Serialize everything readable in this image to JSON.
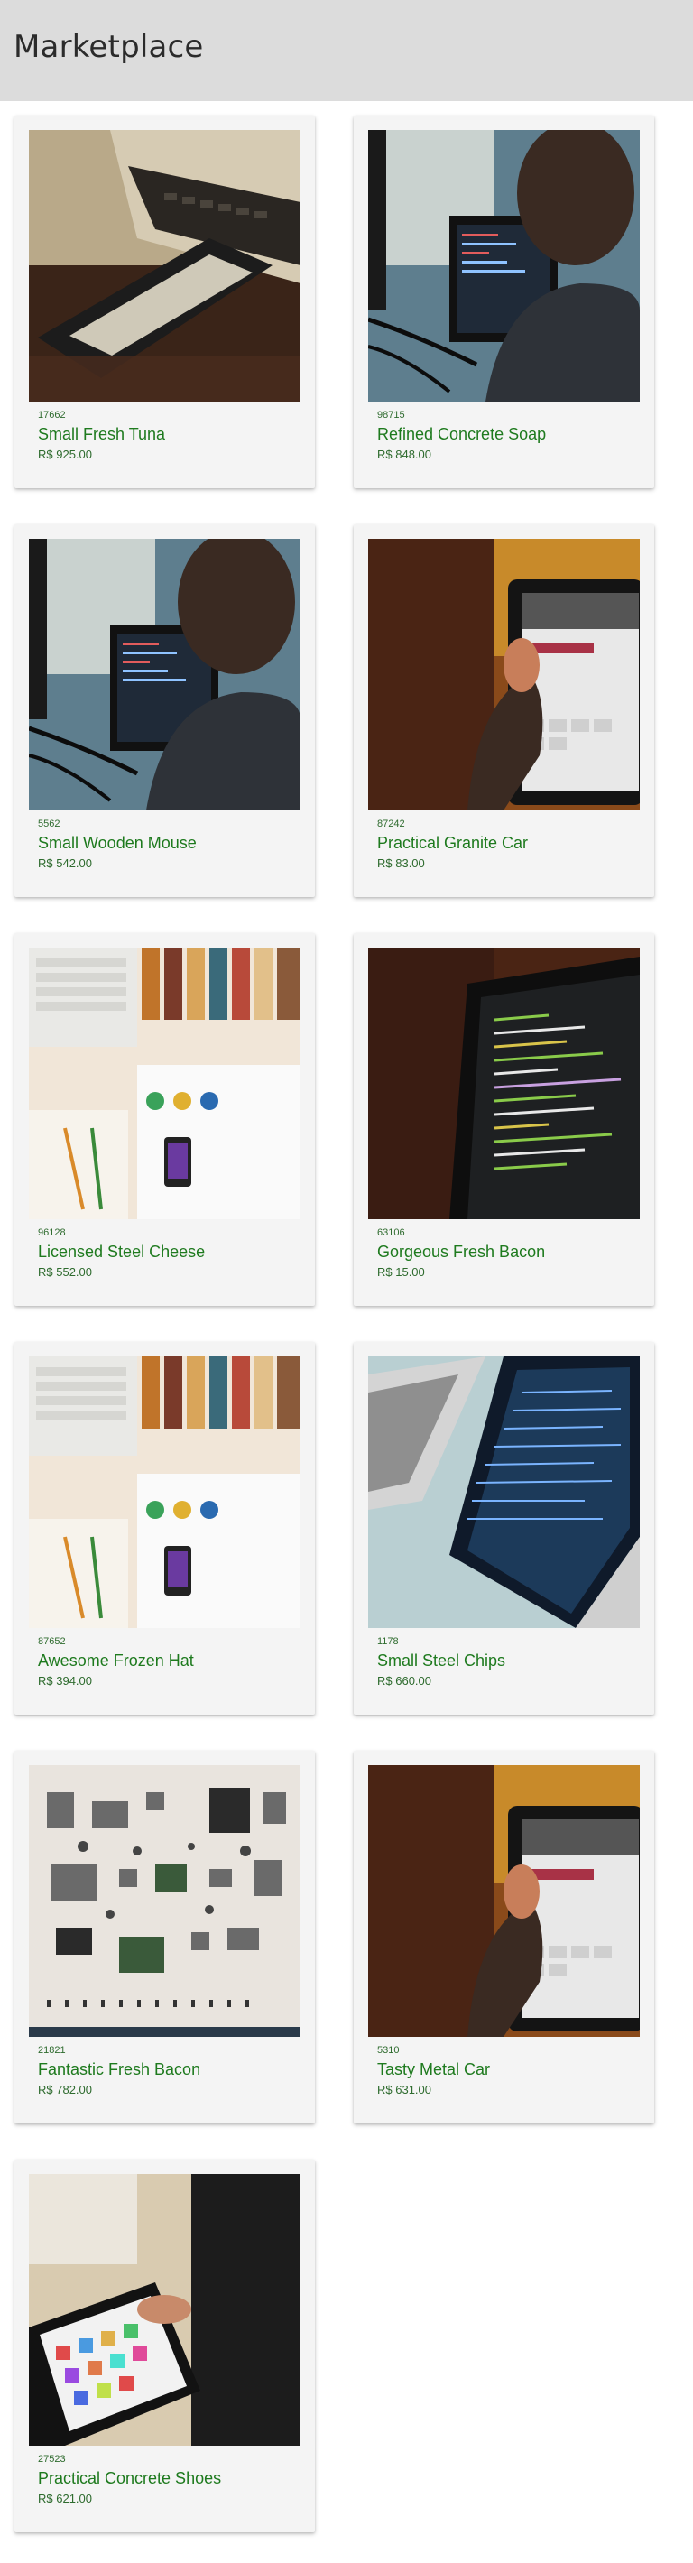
{
  "header": {
    "title": "Marketplace"
  },
  "products": [
    {
      "id": "17662",
      "name": "Small Fresh Tuna",
      "price": "R$ 925.00",
      "image": "phone-on-laptop"
    },
    {
      "id": "98715",
      "name": "Refined Concrete Soap",
      "price": "R$ 848.00",
      "image": "person-at-monitor"
    },
    {
      "id": "5562",
      "name": "Small Wooden Mouse",
      "price": "R$ 542.00",
      "image": "person-at-monitor"
    },
    {
      "id": "87242",
      "name": "Practical Granite Car",
      "price": "R$ 83.00",
      "image": "hand-holding-tablet"
    },
    {
      "id": "96128",
      "name": "Licensed Steel Cheese",
      "price": "R$ 552.00",
      "image": "design-desk"
    },
    {
      "id": "63106",
      "name": "Gorgeous Fresh Bacon",
      "price": "R$ 15.00",
      "image": "code-on-screen"
    },
    {
      "id": "87652",
      "name": "Awesome Frozen Hat",
      "price": "R$ 394.00",
      "image": "design-desk"
    },
    {
      "id": "1178",
      "name": "Small Steel Chips",
      "price": "R$ 660.00",
      "image": "laptop-code"
    },
    {
      "id": "21821",
      "name": "Fantastic Fresh Bacon",
      "price": "R$ 782.00",
      "image": "electronic-parts"
    },
    {
      "id": "5310",
      "name": "Tasty Metal Car",
      "price": "R$ 631.00",
      "image": "hand-holding-tablet"
    },
    {
      "id": "27523",
      "name": "Practical Concrete Shoes",
      "price": "R$ 621.00",
      "image": "tablet-apps"
    }
  ]
}
